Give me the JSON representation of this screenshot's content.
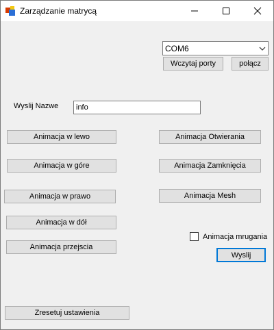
{
  "window": {
    "title": "Zarządzanie matrycą"
  },
  "port": {
    "selected": "COM6",
    "load_ports_label": "Wczytaj porty",
    "connect_label": "połącz"
  },
  "send_name": {
    "label": "Wyslij Nazwe",
    "value": "info"
  },
  "animations": {
    "left": "Animacja w lewo",
    "up": "Animacja w góre",
    "right": "Animacja w prawo",
    "down": "Animacja w dół",
    "transition": "Animacja przejscia",
    "opening": "Animacja Otwierania",
    "closing": "Animacja Zamknięcia",
    "mesh": "Animacja Mesh"
  },
  "blink": {
    "label": "Animacja mrugania",
    "checked": false
  },
  "send_label": "Wyslij",
  "reset_label": "Zresetuj ustawienia"
}
